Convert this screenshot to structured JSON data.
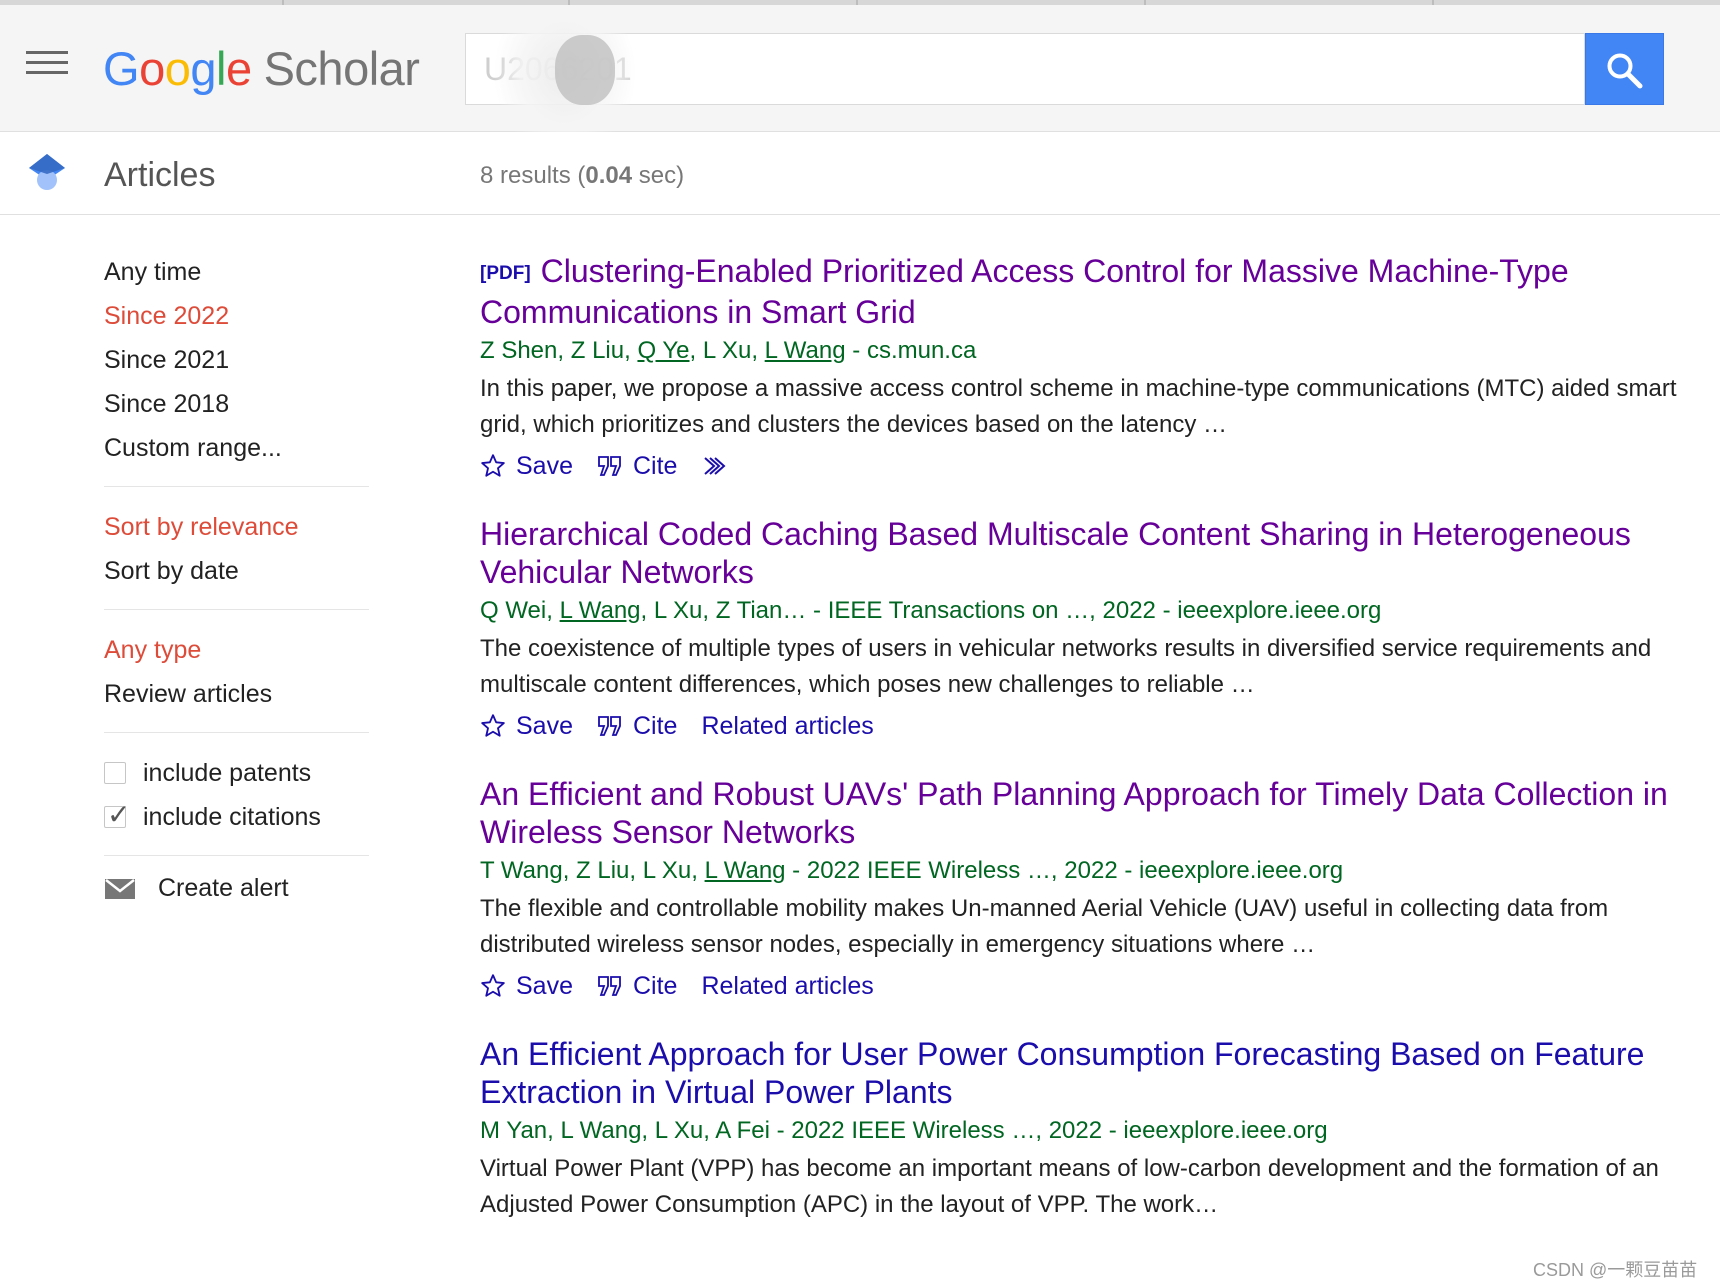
{
  "header": {
    "logo": {
      "G": "G",
      "o1": "o",
      "o2": "o",
      "g": "g",
      "l": "l",
      "e": "e",
      "rest": "Scholar"
    },
    "search_value": "U2066201"
  },
  "subbar": {
    "title": "Articles",
    "stats": {
      "count": "8 results",
      "open": " (",
      "time": "0.04",
      "close": " sec)"
    }
  },
  "sidebar": {
    "time_filters": [
      "Any time",
      "Since 2022",
      "Since 2021",
      "Since 2018",
      "Custom range..."
    ],
    "sort": [
      "Sort by relevance",
      "Sort by date"
    ],
    "types": [
      "Any type",
      "Review articles"
    ],
    "include_patents": "include patents",
    "include_citations": "include citations",
    "create_alert": "Create alert"
  },
  "results": [
    {
      "pdf_tag": "[PDF]",
      "title": "Clustering-Enabled Prioritized Access Control for Massive Machine-Type Communications in Smart Grid",
      "authors": {
        "a1": "Z Shen",
        "a2": "Z Liu",
        "a3": "Q Ye",
        "a4": "L Xu",
        "a5": "L Wang",
        "tail": "cs.mun.ca"
      },
      "snippet": "In this paper, we propose a massive access control scheme in machine-type communications (MTC) aided smart grid, which prioritizes and clusters the devices based on the latency …",
      "save": "Save",
      "cite": "Cite"
    },
    {
      "title": "Hierarchical Coded Caching Based Multiscale Content Sharing in Heterogeneous Vehicular Networks",
      "authors": {
        "a1": "Q Wei",
        "a2": "L Wang",
        "a3": "L Xu",
        "a4": "Z Tian…",
        "tail": "IEEE Transactions on …, 2022 - ieeexplore.ieee.org"
      },
      "snippet": "The coexistence of multiple types of users in vehicular networks results in diversified service requirements and multiscale content differences, which poses new challenges to reliable …",
      "save": "Save",
      "cite": "Cite",
      "related": "Related articles"
    },
    {
      "title": "An Efficient and Robust UAVs' Path Planning Approach for Timely Data Collection in Wireless Sensor Networks",
      "authors": {
        "a1": "T Wang",
        "a2": "Z Liu",
        "a3": "L Xu",
        "a4": "L Wang",
        "tail": "2022 IEEE Wireless …, 2022 - ieeexplore.ieee.org"
      },
      "snippet": "The flexible and controllable mobility makes Un-manned Aerial Vehicle (UAV) useful in collecting data from distributed wireless sensor nodes, especially in emergency situations where …",
      "save": "Save",
      "cite": "Cite",
      "related": "Related articles"
    },
    {
      "title": "An Efficient Approach for User Power Consumption Forecasting Based on Feature Extraction in Virtual Power Plants",
      "authors": "M Yan, L Wang, L Xu, A Fei - 2022 IEEE Wireless …, 2022 - ieeexplore.ieee.org",
      "snippet": "Virtual Power Plant (VPP) has become an important means of low-carbon development and the formation of an Adjusted Power Consumption (APC) in the layout of VPP. The work…"
    }
  ],
  "watermark": "CSDN @一颗豆苗苗"
}
